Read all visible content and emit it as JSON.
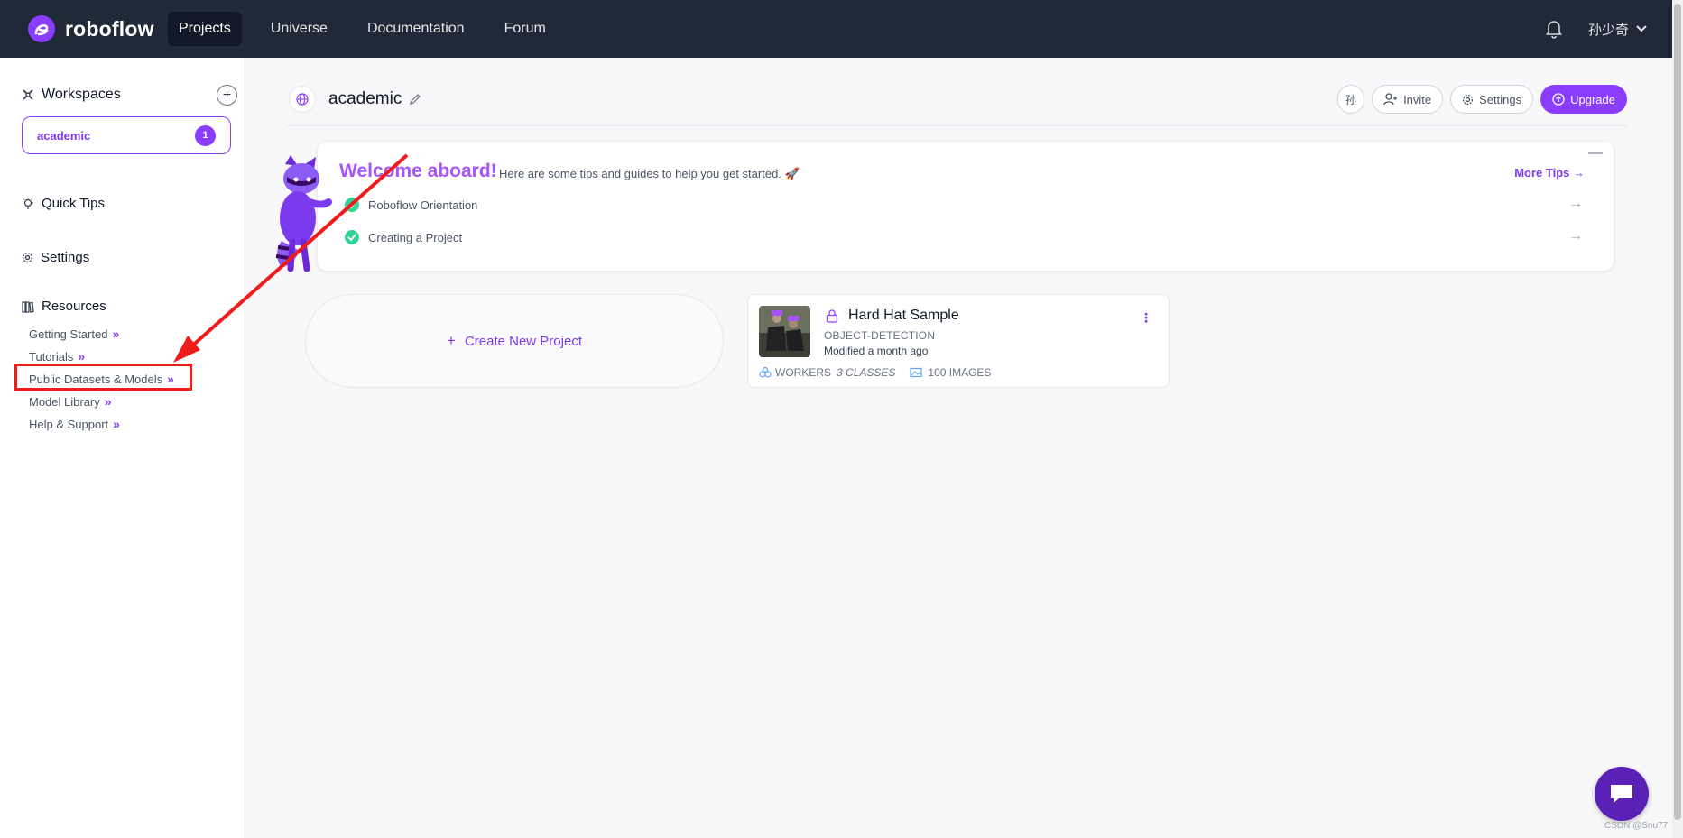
{
  "brand": {
    "name": "roboflow"
  },
  "topnav": {
    "items": [
      {
        "label": "Projects",
        "active": true
      },
      {
        "label": "Universe",
        "active": false
      },
      {
        "label": "Documentation",
        "active": false
      },
      {
        "label": "Forum",
        "active": false
      }
    ],
    "username": "孙少奇"
  },
  "sidebar": {
    "workspaces_title": "Workspaces",
    "workspace": {
      "name": "academic",
      "count": "1"
    },
    "quick_tips": "Quick Tips",
    "settings": "Settings",
    "resources_title": "Resources",
    "resources": [
      "Getting Started",
      "Tutorials",
      "Public Datasets & Models",
      "Model Library",
      "Help & Support"
    ]
  },
  "header": {
    "workspace_name": "academic",
    "invite": "Invite",
    "settings": "Settings",
    "upgrade": "Upgrade",
    "avatar_char": "孙"
  },
  "welcome": {
    "title": "Welcome aboard!",
    "subtitle": "Here are some tips and guides to help you get started. 🚀",
    "more_tips": "More Tips",
    "items": [
      "Roboflow Orientation",
      "Creating a Project"
    ]
  },
  "create_project": "Create New Project",
  "project": {
    "name": "Hard Hat Sample",
    "type": "OBJECT-DETECTION",
    "modified": "Modified a month ago",
    "group": "WORKERS",
    "classes": "3 CLASSES",
    "images": "100 IMAGES"
  },
  "watermark": "CSDN @Snu77",
  "colors": {
    "accent": "#8b3dff",
    "topbar": "#1f2937",
    "annotation_red": "#ef1c1c"
  }
}
